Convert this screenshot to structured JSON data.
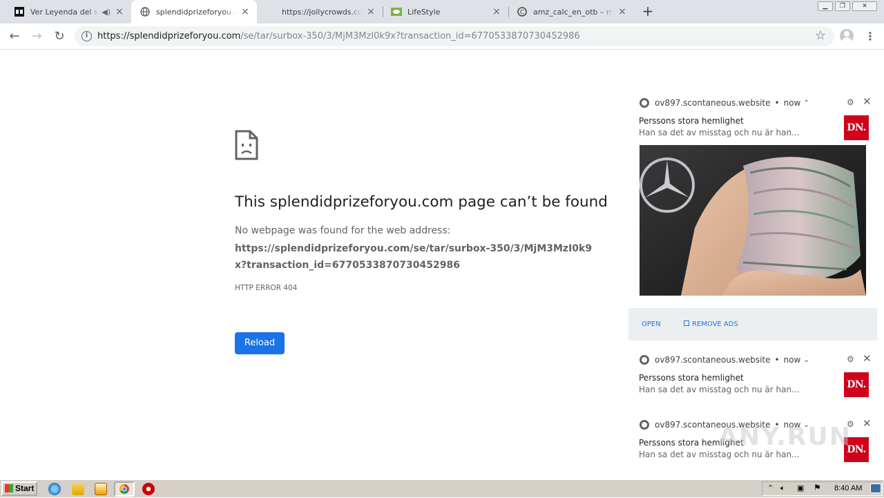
{
  "browser": {
    "tabs": [
      {
        "title": "Ver Leyenda del sub",
        "has_audio": true,
        "active": false
      },
      {
        "title": "splendidprizeforyou.com",
        "active": true
      },
      {
        "title": "https://jollycrowds.com/",
        "active": false
      },
      {
        "title": "LifeStyle",
        "active": false
      },
      {
        "title": "amz_calc_en_otb – mysi",
        "active": false
      }
    ],
    "url_host": "https://splendidprizeforyou.com",
    "url_path": "/se/tar/surbox-350/3/MjM3MzI0k9x?transaction_id=6770533870730452986"
  },
  "error_page": {
    "title": "This splendidprizeforyou.com page can’t be found",
    "description": "No webpage was found for the web address:",
    "url": "https://splendidprizeforyou.com/se/tar/surbox-350/3/MjM3MzI0k9x?transaction_id=6770533870730452986",
    "error_code": "HTTP ERROR 404",
    "reload_label": "Reload"
  },
  "notifications": [
    {
      "source": "ov897.scontaneous.website",
      "time": "now",
      "chevron": "⌃",
      "title": "Perssons stora hemlighet",
      "body": "Han sa det av misstag och nu är han...",
      "logo": "DN.",
      "expanded": true,
      "actions": {
        "open": "OPEN",
        "remove_ads": "REMOVE ADS"
      }
    },
    {
      "source": "ov897.scontaneous.website",
      "time": "now",
      "chevron": "⌄",
      "title": "Perssons stora hemlighet",
      "body": "Han sa det av misstag och nu är han...",
      "logo": "DN."
    },
    {
      "source": "ov897.scontaneous.website",
      "time": "now",
      "chevron": "⌄",
      "title": "Perssons stora hemlighet",
      "body": "Han sa det av misstag och nu är han...",
      "logo": "DN."
    }
  ],
  "watermark": "ANY.RUN",
  "taskbar": {
    "start_label": "Start",
    "clock": "8:40 AM"
  },
  "colors": {
    "accent": "#1a73e8",
    "dn_red": "#d0021b",
    "tabstrip": "#dee1e6"
  }
}
